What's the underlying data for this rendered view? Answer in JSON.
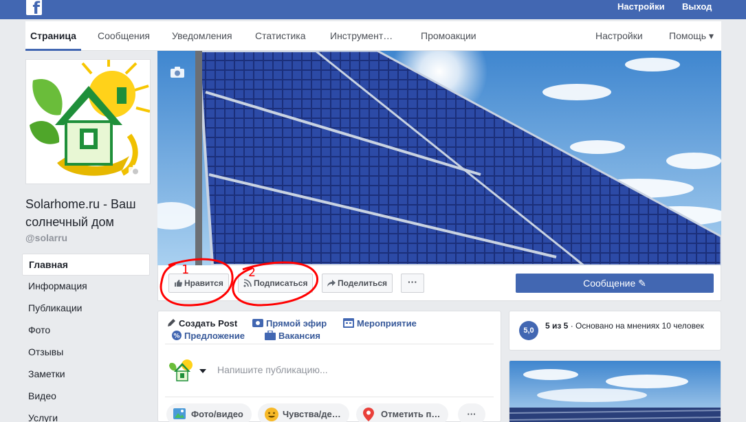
{
  "topbar": {
    "settings": "Настройки",
    "logout": "Выход",
    "logo_letter": "f"
  },
  "tabs": [
    {
      "label": "Страница"
    },
    {
      "label": "Сообщения"
    },
    {
      "label": "Уведомления"
    },
    {
      "label": "Статистика"
    },
    {
      "label": "Инструмент…"
    },
    {
      "label": "Промоакции"
    }
  ],
  "tabs_right": {
    "settings": "Настройки",
    "help": "Помощь ▾"
  },
  "page": {
    "name": "Solarhome.ru - Ваш солнечный дом",
    "handle": "@solarru"
  },
  "sidebar": {
    "items": [
      {
        "label": "Главная"
      },
      {
        "label": "Информация"
      },
      {
        "label": "Публикации"
      },
      {
        "label": "Фото"
      },
      {
        "label": "Отзывы"
      },
      {
        "label": "Заметки"
      },
      {
        "label": "Видео"
      },
      {
        "label": "Услуги"
      }
    ]
  },
  "actions": {
    "like": "Нравится",
    "follow": "Подписаться",
    "share": "Поделиться",
    "more": "···",
    "message": "Сообщение ✎"
  },
  "annotations": {
    "n1": "1",
    "n2": "2",
    "color": "#ff0000"
  },
  "composer": {
    "create_post": "Создать Post",
    "live": "Прямой эфир",
    "event": "Мероприятие",
    "offer": "Предложение",
    "jobs": "Вакансия",
    "placeholder": "Напишите публикацию...",
    "photo_video": "Фото/видео",
    "feelings": "Чувства/де…",
    "checkin": "Отметить п…",
    "more": "···"
  },
  "rating": {
    "badge": "5,0",
    "score": "5 из 5",
    "text": " · Основано на мнениях 10 человек"
  },
  "colors": {
    "brand": "#4267b2",
    "bg": "#e9ebee"
  }
}
